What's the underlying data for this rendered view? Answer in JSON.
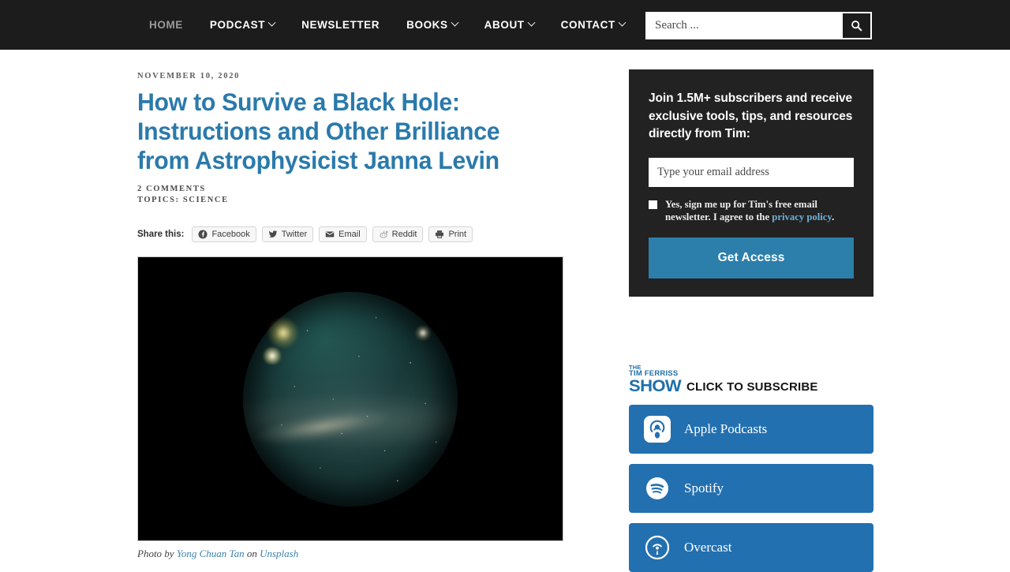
{
  "header": {
    "nav": [
      {
        "label": "HOME",
        "has_dropdown": false,
        "current": true
      },
      {
        "label": "PODCAST",
        "has_dropdown": true,
        "current": false
      },
      {
        "label": "NEWSLETTER",
        "has_dropdown": false,
        "current": false
      },
      {
        "label": "BOOKS",
        "has_dropdown": true,
        "current": false
      },
      {
        "label": "ABOUT",
        "has_dropdown": true,
        "current": false
      },
      {
        "label": "CONTACT",
        "has_dropdown": true,
        "current": false
      }
    ],
    "search": {
      "placeholder": "Search ...",
      "value": "",
      "button_icon": "search-icon"
    },
    "background_color": "#1c1c1c"
  },
  "article": {
    "date": "NOVEMBER 10, 2020",
    "title": "How to Survive a Black Hole: Instructions and Other Brilliance from Astrophysicist Janna Levin",
    "title_color": "#2a7aab",
    "comments": "2 COMMENTS",
    "topics_prefix": "TOPICS:",
    "topics": "SCIENCE",
    "topics_line": "TOPICS: SCIENCE",
    "share": {
      "label": "Share this:",
      "buttons": [
        {
          "label": "Facebook",
          "icon": "facebook-icon"
        },
        {
          "label": "Twitter",
          "icon": "twitter-icon"
        },
        {
          "label": "Email",
          "icon": "email-icon"
        },
        {
          "label": "Reddit",
          "icon": "reddit-icon"
        },
        {
          "label": "Print",
          "icon": "print-icon"
        }
      ]
    },
    "photo": {
      "alt": "Fisheye night sky photo of the Milky Way over a dark horizon",
      "caption_prefix": "Photo by ",
      "caption_author": "Yong Chuan Tan",
      "caption_middle": " on ",
      "caption_source": "Unsplash"
    }
  },
  "sidebar": {
    "optin": {
      "heading": "Join 1.5M+ subscribers and receive exclusive tools, tips, and resources directly from Tim:",
      "email_placeholder": "Type your email address",
      "email_value": "",
      "consent_checked": false,
      "consent_text_before": "Yes, sign me up for Tim's free email newsletter. I agree to the ",
      "consent_link": "privacy policy",
      "consent_text_after": ".",
      "button_label": "Get Access",
      "button_color": "#2c7eab",
      "background_color": "#222222"
    },
    "subscribe": {
      "logo_line1": "THE",
      "logo_line2": "TIM FERRISS",
      "logo_line3": "SHOW",
      "logo_color": "#1f6fa8",
      "heading": "CLICK TO SUBSCRIBE",
      "buttons": [
        {
          "label": "Apple Podcasts",
          "icon": "apple-podcasts-icon"
        },
        {
          "label": "Spotify",
          "icon": "spotify-icon"
        },
        {
          "label": "Overcast",
          "icon": "overcast-icon"
        }
      ],
      "button_color": "#2370b0"
    }
  }
}
